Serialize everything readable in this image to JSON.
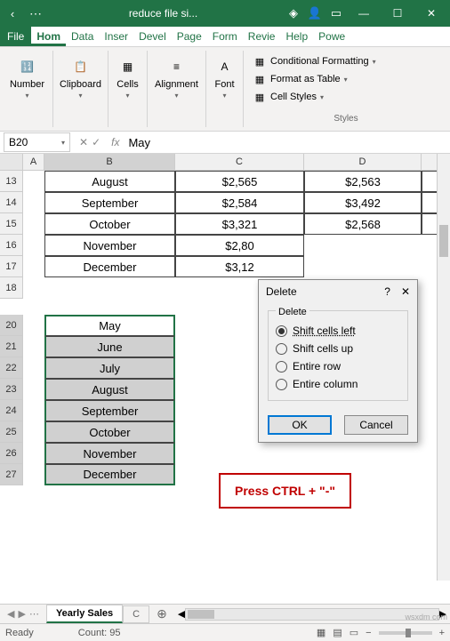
{
  "titlebar": {
    "title": "reduce file si..."
  },
  "filetabs": [
    "File",
    "Hom",
    "Data",
    "Inser",
    "Devel",
    "Page",
    "Form",
    "Revie",
    "Help",
    "Powe"
  ],
  "ribbon": {
    "number": {
      "label": "Number"
    },
    "clipboard": {
      "label": "Clipboard"
    },
    "cells": {
      "label": "Cells"
    },
    "alignment": {
      "label": "Alignment"
    },
    "font": {
      "label": "Font"
    },
    "styles": {
      "cond": "Conditional Formatting",
      "table": "Format as Table",
      "cellstyles": "Cell Styles",
      "label": "Styles"
    }
  },
  "namebox": "B20",
  "formula": "May",
  "columns": [
    "A",
    "B",
    "C",
    "D"
  ],
  "rows_top": [
    {
      "n": "13",
      "b": "August",
      "c": "$2,565",
      "d": "$2,563"
    },
    {
      "n": "14",
      "b": "September",
      "c": "$2,584",
      "d": "$3,492"
    },
    {
      "n": "15",
      "b": "October",
      "c": "$3,321",
      "d": "$2,568"
    },
    {
      "n": "16",
      "b": "November",
      "c": "$2,80",
      "d": ""
    },
    {
      "n": "17",
      "b": "December",
      "c": "$3,12",
      "d": ""
    }
  ],
  "row18": "18",
  "rows_sel": [
    {
      "n": "20",
      "b": "May",
      "active": true
    },
    {
      "n": "21",
      "b": "June"
    },
    {
      "n": "22",
      "b": "July"
    },
    {
      "n": "23",
      "b": "August"
    },
    {
      "n": "24",
      "b": "September"
    },
    {
      "n": "25",
      "b": "October"
    },
    {
      "n": "26",
      "b": "November"
    },
    {
      "n": "27",
      "b": "December"
    }
  ],
  "dialog": {
    "title": "Delete",
    "group": "Delete",
    "opts": {
      "left": "Shift cells left",
      "up": "Shift cells up",
      "row": "Entire row",
      "col": "Entire column"
    },
    "ok": "OK",
    "cancel": "Cancel"
  },
  "callout": "Press CTRL + \"-\"",
  "sheets": {
    "active": "Yearly Sales",
    "other": "C"
  },
  "status": {
    "ready": "Ready",
    "count_label": "Count:",
    "count": "95"
  },
  "watermark": "wsxdm com"
}
